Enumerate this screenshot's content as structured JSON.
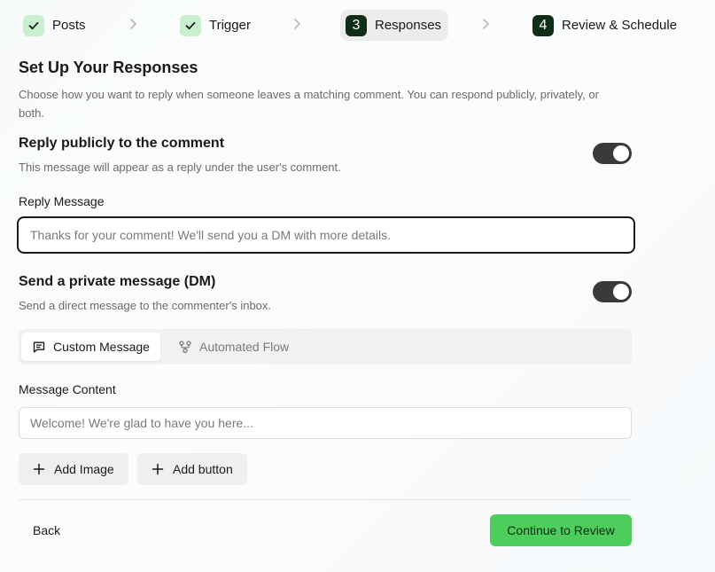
{
  "stepper": {
    "steps": [
      {
        "label": "Posts",
        "state": "completed",
        "icon": "check-icon"
      },
      {
        "label": "Trigger",
        "state": "completed",
        "icon": "check-icon"
      },
      {
        "label": "Responses",
        "state": "active",
        "number": "3"
      },
      {
        "label": "Review & Schedule",
        "state": "upcoming",
        "number": "4"
      }
    ],
    "separator_icon": "chevron-right-icon"
  },
  "page": {
    "title": "Set Up Your Responses",
    "subtitle": "Choose how you want to reply when someone leaves a matching comment. You can respond publicly, privately, or both."
  },
  "public_reply": {
    "title": "Reply publicly to the comment",
    "description": "This message will appear as a reply under the user's comment.",
    "enabled": true,
    "field_label": "Reply Message",
    "placeholder": "Thanks for your comment! We'll send you a DM with more details.",
    "value": ""
  },
  "private_message": {
    "title": "Send a private message (DM)",
    "description": "Send a direct message to the commenter's inbox.",
    "enabled": true,
    "tabs": [
      {
        "label": "Custom Message",
        "icon": "message-square-icon",
        "active": true
      },
      {
        "label": "Automated Flow",
        "icon": "workflow-icon",
        "active": false
      }
    ],
    "field_label": "Message Content",
    "placeholder": "Welcome! We're glad to have you here...",
    "value": "",
    "add_image_label": "Add Image",
    "add_button_label": "Add button"
  },
  "footer": {
    "back_label": "Back",
    "continue_label": "Continue to Review"
  },
  "colors": {
    "accent_green": "#4dcd5b",
    "dark_green": "#0f2d17",
    "check_badge": "#c9efce",
    "toggle_on": "#3a3a3a"
  }
}
